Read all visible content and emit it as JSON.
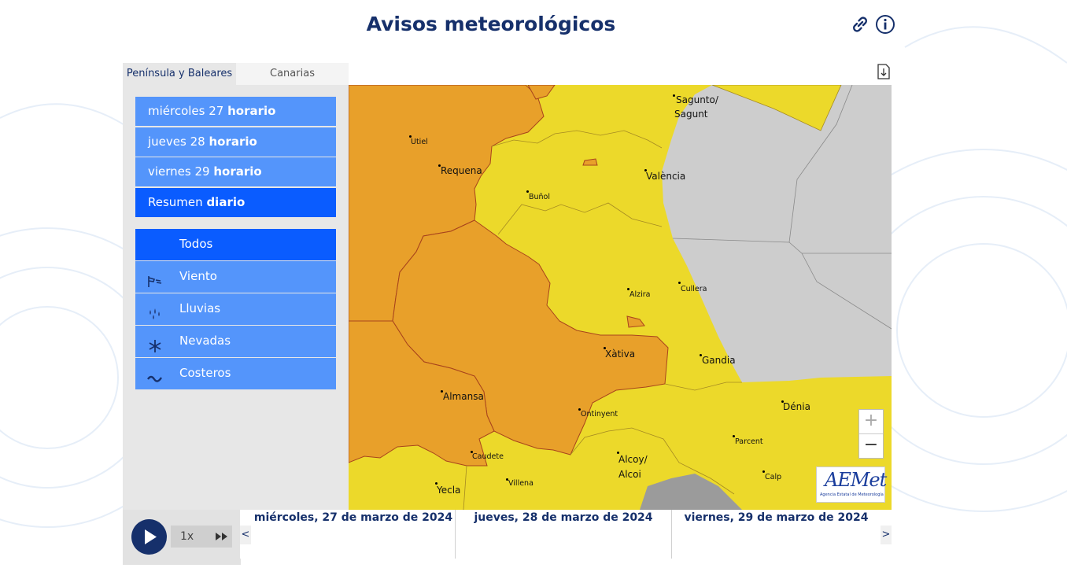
{
  "page_title": "Avisos meteorológicos",
  "icons": {
    "link": "link-icon",
    "info": "info-icon",
    "download": "download-icon"
  },
  "tabs": [
    {
      "label": "Península y Baleares",
      "active": true
    },
    {
      "label": "Canarias",
      "active": false
    }
  ],
  "days": [
    {
      "day": "miércoles 27",
      "mode": "horario",
      "selected": false
    },
    {
      "day": "jueves 28",
      "mode": "horario",
      "selected": false
    },
    {
      "day": "viernes 29",
      "mode": "horario",
      "selected": false
    },
    {
      "day": "Resumen",
      "mode": "diario",
      "selected": true
    }
  ],
  "warning_types": [
    {
      "label": "Todos",
      "icon": "",
      "selected": true
    },
    {
      "label": "Viento",
      "icon": "wind-icon",
      "selected": false
    },
    {
      "label": "Lluvias",
      "icon": "rain-icon",
      "selected": false
    },
    {
      "label": "Nevadas",
      "icon": "snowflake-icon",
      "selected": false
    },
    {
      "label": "Costeros",
      "icon": "wave-icon",
      "selected": false
    }
  ],
  "map": {
    "colors": {
      "orange": "#e8a02a",
      "yellow": "#ecd92a",
      "sea": "#cdcdcd",
      "border_orange": "#a8431c",
      "border_yellow": "#a58a22"
    },
    "cities": [
      {
        "name": "Sagunto/",
        "name2": "Sagunt"
      },
      {
        "name": "Utiel"
      },
      {
        "name": "Requena"
      },
      {
        "name": "Buñol"
      },
      {
        "name": "València"
      },
      {
        "name": "Alzira"
      },
      {
        "name": "Cullera"
      },
      {
        "name": "Xàtiva"
      },
      {
        "name": "Gandia"
      },
      {
        "name": "Dénia"
      },
      {
        "name": "Almansa"
      },
      {
        "name": "Ontinyent"
      },
      {
        "name": "Parcent"
      },
      {
        "name": "Caudete"
      },
      {
        "name": "Alcoy/",
        "name2": "Alcoi"
      },
      {
        "name": "Calp"
      },
      {
        "name": "Villena"
      },
      {
        "name": "Yecla"
      }
    ],
    "zoom_in": "+",
    "zoom_out": "−",
    "logo_text": "AEMet",
    "logo_sub": "Agencia Estatal de Meteorología"
  },
  "player": {
    "speed": "1x"
  },
  "timeline": {
    "days": [
      "miércoles, 27 de marzo de 2024",
      "jueves, 28 de marzo de 2024",
      "viernes, 29 de marzo de 2024"
    ],
    "prev": "<",
    "next": ">"
  }
}
